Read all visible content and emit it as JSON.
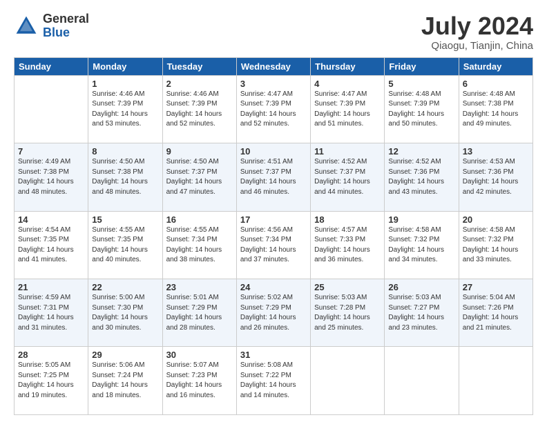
{
  "logo": {
    "general": "General",
    "blue": "Blue"
  },
  "title": "July 2024",
  "location": "Qiaogu, Tianjin, China",
  "weekdays": [
    "Sunday",
    "Monday",
    "Tuesday",
    "Wednesday",
    "Thursday",
    "Friday",
    "Saturday"
  ],
  "weeks": [
    [
      {
        "day": "",
        "sunrise": "",
        "sunset": "",
        "daylight": ""
      },
      {
        "day": "1",
        "sunrise": "Sunrise: 4:46 AM",
        "sunset": "Sunset: 7:39 PM",
        "daylight": "Daylight: 14 hours and 53 minutes."
      },
      {
        "day": "2",
        "sunrise": "Sunrise: 4:46 AM",
        "sunset": "Sunset: 7:39 PM",
        "daylight": "Daylight: 14 hours and 52 minutes."
      },
      {
        "day": "3",
        "sunrise": "Sunrise: 4:47 AM",
        "sunset": "Sunset: 7:39 PM",
        "daylight": "Daylight: 14 hours and 52 minutes."
      },
      {
        "day": "4",
        "sunrise": "Sunrise: 4:47 AM",
        "sunset": "Sunset: 7:39 PM",
        "daylight": "Daylight: 14 hours and 51 minutes."
      },
      {
        "day": "5",
        "sunrise": "Sunrise: 4:48 AM",
        "sunset": "Sunset: 7:39 PM",
        "daylight": "Daylight: 14 hours and 50 minutes."
      },
      {
        "day": "6",
        "sunrise": "Sunrise: 4:48 AM",
        "sunset": "Sunset: 7:38 PM",
        "daylight": "Daylight: 14 hours and 49 minutes."
      }
    ],
    [
      {
        "day": "7",
        "sunrise": "Sunrise: 4:49 AM",
        "sunset": "Sunset: 7:38 PM",
        "daylight": "Daylight: 14 hours and 48 minutes."
      },
      {
        "day": "8",
        "sunrise": "Sunrise: 4:50 AM",
        "sunset": "Sunset: 7:38 PM",
        "daylight": "Daylight: 14 hours and 48 minutes."
      },
      {
        "day": "9",
        "sunrise": "Sunrise: 4:50 AM",
        "sunset": "Sunset: 7:37 PM",
        "daylight": "Daylight: 14 hours and 47 minutes."
      },
      {
        "day": "10",
        "sunrise": "Sunrise: 4:51 AM",
        "sunset": "Sunset: 7:37 PM",
        "daylight": "Daylight: 14 hours and 46 minutes."
      },
      {
        "day": "11",
        "sunrise": "Sunrise: 4:52 AM",
        "sunset": "Sunset: 7:37 PM",
        "daylight": "Daylight: 14 hours and 44 minutes."
      },
      {
        "day": "12",
        "sunrise": "Sunrise: 4:52 AM",
        "sunset": "Sunset: 7:36 PM",
        "daylight": "Daylight: 14 hours and 43 minutes."
      },
      {
        "day": "13",
        "sunrise": "Sunrise: 4:53 AM",
        "sunset": "Sunset: 7:36 PM",
        "daylight": "Daylight: 14 hours and 42 minutes."
      }
    ],
    [
      {
        "day": "14",
        "sunrise": "Sunrise: 4:54 AM",
        "sunset": "Sunset: 7:35 PM",
        "daylight": "Daylight: 14 hours and 41 minutes."
      },
      {
        "day": "15",
        "sunrise": "Sunrise: 4:55 AM",
        "sunset": "Sunset: 7:35 PM",
        "daylight": "Daylight: 14 hours and 40 minutes."
      },
      {
        "day": "16",
        "sunrise": "Sunrise: 4:55 AM",
        "sunset": "Sunset: 7:34 PM",
        "daylight": "Daylight: 14 hours and 38 minutes."
      },
      {
        "day": "17",
        "sunrise": "Sunrise: 4:56 AM",
        "sunset": "Sunset: 7:34 PM",
        "daylight": "Daylight: 14 hours and 37 minutes."
      },
      {
        "day": "18",
        "sunrise": "Sunrise: 4:57 AM",
        "sunset": "Sunset: 7:33 PM",
        "daylight": "Daylight: 14 hours and 36 minutes."
      },
      {
        "day": "19",
        "sunrise": "Sunrise: 4:58 AM",
        "sunset": "Sunset: 7:32 PM",
        "daylight": "Daylight: 14 hours and 34 minutes."
      },
      {
        "day": "20",
        "sunrise": "Sunrise: 4:58 AM",
        "sunset": "Sunset: 7:32 PM",
        "daylight": "Daylight: 14 hours and 33 minutes."
      }
    ],
    [
      {
        "day": "21",
        "sunrise": "Sunrise: 4:59 AM",
        "sunset": "Sunset: 7:31 PM",
        "daylight": "Daylight: 14 hours and 31 minutes."
      },
      {
        "day": "22",
        "sunrise": "Sunrise: 5:00 AM",
        "sunset": "Sunset: 7:30 PM",
        "daylight": "Daylight: 14 hours and 30 minutes."
      },
      {
        "day": "23",
        "sunrise": "Sunrise: 5:01 AM",
        "sunset": "Sunset: 7:29 PM",
        "daylight": "Daylight: 14 hours and 28 minutes."
      },
      {
        "day": "24",
        "sunrise": "Sunrise: 5:02 AM",
        "sunset": "Sunset: 7:29 PM",
        "daylight": "Daylight: 14 hours and 26 minutes."
      },
      {
        "day": "25",
        "sunrise": "Sunrise: 5:03 AM",
        "sunset": "Sunset: 7:28 PM",
        "daylight": "Daylight: 14 hours and 25 minutes."
      },
      {
        "day": "26",
        "sunrise": "Sunrise: 5:03 AM",
        "sunset": "Sunset: 7:27 PM",
        "daylight": "Daylight: 14 hours and 23 minutes."
      },
      {
        "day": "27",
        "sunrise": "Sunrise: 5:04 AM",
        "sunset": "Sunset: 7:26 PM",
        "daylight": "Daylight: 14 hours and 21 minutes."
      }
    ],
    [
      {
        "day": "28",
        "sunrise": "Sunrise: 5:05 AM",
        "sunset": "Sunset: 7:25 PM",
        "daylight": "Daylight: 14 hours and 19 minutes."
      },
      {
        "day": "29",
        "sunrise": "Sunrise: 5:06 AM",
        "sunset": "Sunset: 7:24 PM",
        "daylight": "Daylight: 14 hours and 18 minutes."
      },
      {
        "day": "30",
        "sunrise": "Sunrise: 5:07 AM",
        "sunset": "Sunset: 7:23 PM",
        "daylight": "Daylight: 14 hours and 16 minutes."
      },
      {
        "day": "31",
        "sunrise": "Sunrise: 5:08 AM",
        "sunset": "Sunset: 7:22 PM",
        "daylight": "Daylight: 14 hours and 14 minutes."
      },
      {
        "day": "",
        "sunrise": "",
        "sunset": "",
        "daylight": ""
      },
      {
        "day": "",
        "sunrise": "",
        "sunset": "",
        "daylight": ""
      },
      {
        "day": "",
        "sunrise": "",
        "sunset": "",
        "daylight": ""
      }
    ]
  ]
}
